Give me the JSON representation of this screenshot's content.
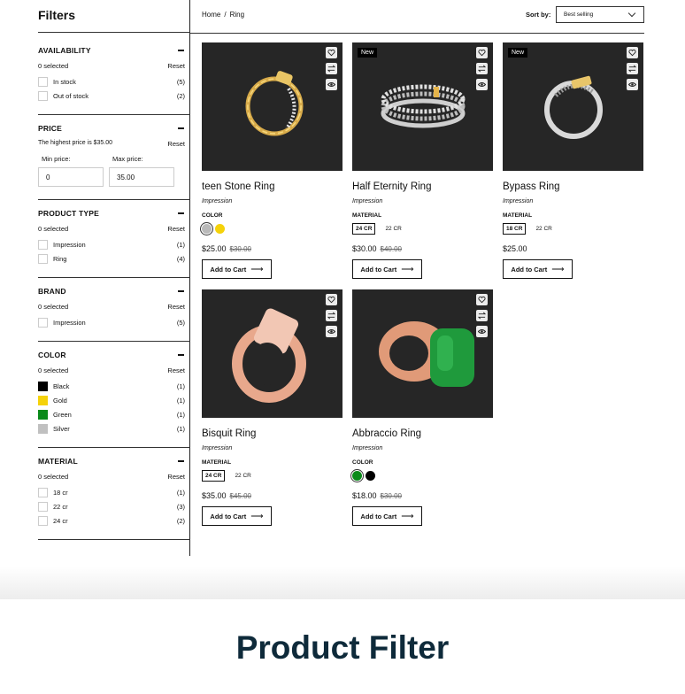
{
  "sidebar": {
    "title": "Filters",
    "availability": {
      "title": "AVAILABILITY",
      "selected": "0 selected",
      "reset": "Reset",
      "options": [
        {
          "label": "In stock",
          "count": "(5)"
        },
        {
          "label": "Out of stock",
          "count": "(2)"
        }
      ]
    },
    "price": {
      "title": "PRICE",
      "note": "The highest price is $35.00",
      "reset": "Reset",
      "min_label": "Min price:",
      "max_label": "Max price:",
      "min_value": "0",
      "max_value": "35.00"
    },
    "product_type": {
      "title": "PRODUCT TYPE",
      "selected": "0 selected",
      "reset": "Reset",
      "options": [
        {
          "label": "Impression",
          "count": "(1)"
        },
        {
          "label": "Ring",
          "count": "(4)"
        }
      ]
    },
    "brand": {
      "title": "BRAND",
      "selected": "0 selected",
      "reset": "Reset",
      "options": [
        {
          "label": "Impression",
          "count": "(5)"
        }
      ]
    },
    "color": {
      "title": "COLOR",
      "selected": "0 selected",
      "reset": "Reset",
      "options": [
        {
          "label": "Black",
          "count": "(1)",
          "hex": "#000000"
        },
        {
          "label": "Gold",
          "count": "(1)",
          "hex": "#f5d20a"
        },
        {
          "label": "Green",
          "count": "(1)",
          "hex": "#0a8a1a"
        },
        {
          "label": "Silver",
          "count": "(1)",
          "hex": "#c0c0c0"
        }
      ]
    },
    "material": {
      "title": "MATERIAL",
      "selected": "0 selected",
      "reset": "Reset",
      "options": [
        {
          "label": "18 cr",
          "count": "(1)"
        },
        {
          "label": "22 cr",
          "count": "(3)"
        },
        {
          "label": "24 cr",
          "count": "(2)"
        }
      ]
    }
  },
  "breadcrumb": {
    "home": "Home",
    "sep": "/",
    "current": "Ring"
  },
  "sort": {
    "label": "Sort by:",
    "value": "Best selling"
  },
  "products": [
    {
      "name": "teen Stone Ring",
      "brand": "Impression",
      "attr": "COLOR",
      "price": "$25.00",
      "old_price": "$30.00",
      "cart": "Add to Cart",
      "colors": [
        "#b9b9b9",
        "#f5d20a"
      ]
    },
    {
      "name": "Half Eternity Ring",
      "brand": "Impression",
      "badge": "New",
      "attr": "MATERIAL",
      "price": "$30.00",
      "old_price": "$40.00",
      "cart": "Add to Cart",
      "materials": [
        "24 CR",
        "22 CR"
      ]
    },
    {
      "name": "Bypass Ring",
      "brand": "Impression",
      "badge": "New",
      "attr": "MATERIAL",
      "price": "$25.00",
      "cart": "Add to Cart",
      "materials": [
        "18 CR",
        "22 CR"
      ]
    },
    {
      "name": "Bisquit Ring",
      "brand": "Impression",
      "attr": "MATERIAL",
      "price": "$35.00",
      "old_price": "$45.00",
      "cart": "Add to Cart",
      "materials": [
        "24 CR",
        "22 CR"
      ]
    },
    {
      "name": "Abbraccio Ring",
      "brand": "Impression",
      "attr": "COLOR",
      "price": "$18.00",
      "old_price": "$30.00",
      "cart": "Add to Cart",
      "colors": [
        "#0a8a1a",
        "#000000"
      ]
    }
  ],
  "banner": {
    "title": "Product Filter"
  },
  "theme": {
    "text": "#111111",
    "image_bg": "#262626",
    "banner_text": "#0e2a3a"
  }
}
